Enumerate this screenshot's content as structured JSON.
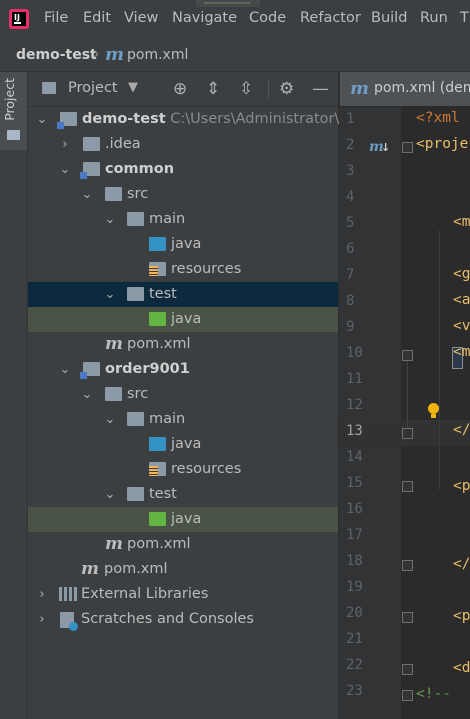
{
  "menubar": {
    "items": [
      "File",
      "Edit",
      "View",
      "Navigate",
      "Code",
      "Refactor",
      "Build",
      "Run",
      "T"
    ],
    "mnemonics": [
      "F",
      "E",
      "V",
      "N",
      "C",
      "R",
      "B",
      "u",
      "T"
    ]
  },
  "breadcrumb": {
    "project": "demo-test",
    "file": "pom.xml"
  },
  "sidebar": {
    "project_tab_label": "Project"
  },
  "project_panel": {
    "title": "Project",
    "tree": [
      {
        "label": "demo-test",
        "hint": "C:\\Users\\Administrator\\De",
        "type": "module",
        "bold": true,
        "expanded": true
      },
      {
        "label": ".idea",
        "type": "folder",
        "expanded": false
      },
      {
        "label": "common",
        "type": "module",
        "bold": true,
        "expanded": true
      },
      {
        "label": "src",
        "type": "folder",
        "expanded": true
      },
      {
        "label": "main",
        "type": "folder",
        "expanded": true
      },
      {
        "label": "java",
        "type": "source-folder"
      },
      {
        "label": "resources",
        "type": "resources-folder"
      },
      {
        "label": "test",
        "type": "folder",
        "expanded": true
      },
      {
        "label": "java",
        "type": "test-folder"
      },
      {
        "label": "pom.xml",
        "type": "maven-file"
      },
      {
        "label": "order9001",
        "type": "module",
        "bold": true,
        "expanded": true
      },
      {
        "label": "src",
        "type": "folder",
        "expanded": true
      },
      {
        "label": "main",
        "type": "folder",
        "expanded": true
      },
      {
        "label": "java",
        "type": "source-folder"
      },
      {
        "label": "resources",
        "type": "resources-folder"
      },
      {
        "label": "test",
        "type": "folder",
        "expanded": true
      },
      {
        "label": "java",
        "type": "test-folder"
      },
      {
        "label": "pom.xml",
        "type": "maven-file"
      },
      {
        "label": "pom.xml",
        "type": "maven-file"
      },
      {
        "label": "External Libraries",
        "type": "libraries",
        "expanded": false
      },
      {
        "label": "Scratches and Consoles",
        "type": "scratches",
        "expanded": false
      }
    ]
  },
  "editor": {
    "tab_label": "pom.xml (dem",
    "line_numbers": [
      "1",
      "2",
      "3",
      "4",
      "5",
      "6",
      "7",
      "8",
      "9",
      "10",
      "11",
      "12",
      "13",
      "14",
      "15",
      "16",
      "17",
      "18",
      "19",
      "20",
      "21",
      "22",
      "23"
    ],
    "current_line": "13",
    "code": {
      "l1": "<?xml",
      "l2": "<proje",
      "l5": "<m",
      "l7": "<g",
      "l8": "<a",
      "l9": "<v",
      "l10": "<m",
      "l13": "</",
      "l15": "<p",
      "l18": "</",
      "l20": "<p",
      "l22": "<d",
      "l23": "<!--"
    }
  },
  "colors": {
    "accent_tag": "#e8bf6a",
    "accent_keyword": "#cc7832",
    "comment": "#629755",
    "selection_blue": "#0d293e",
    "selection_green": "#495447"
  }
}
